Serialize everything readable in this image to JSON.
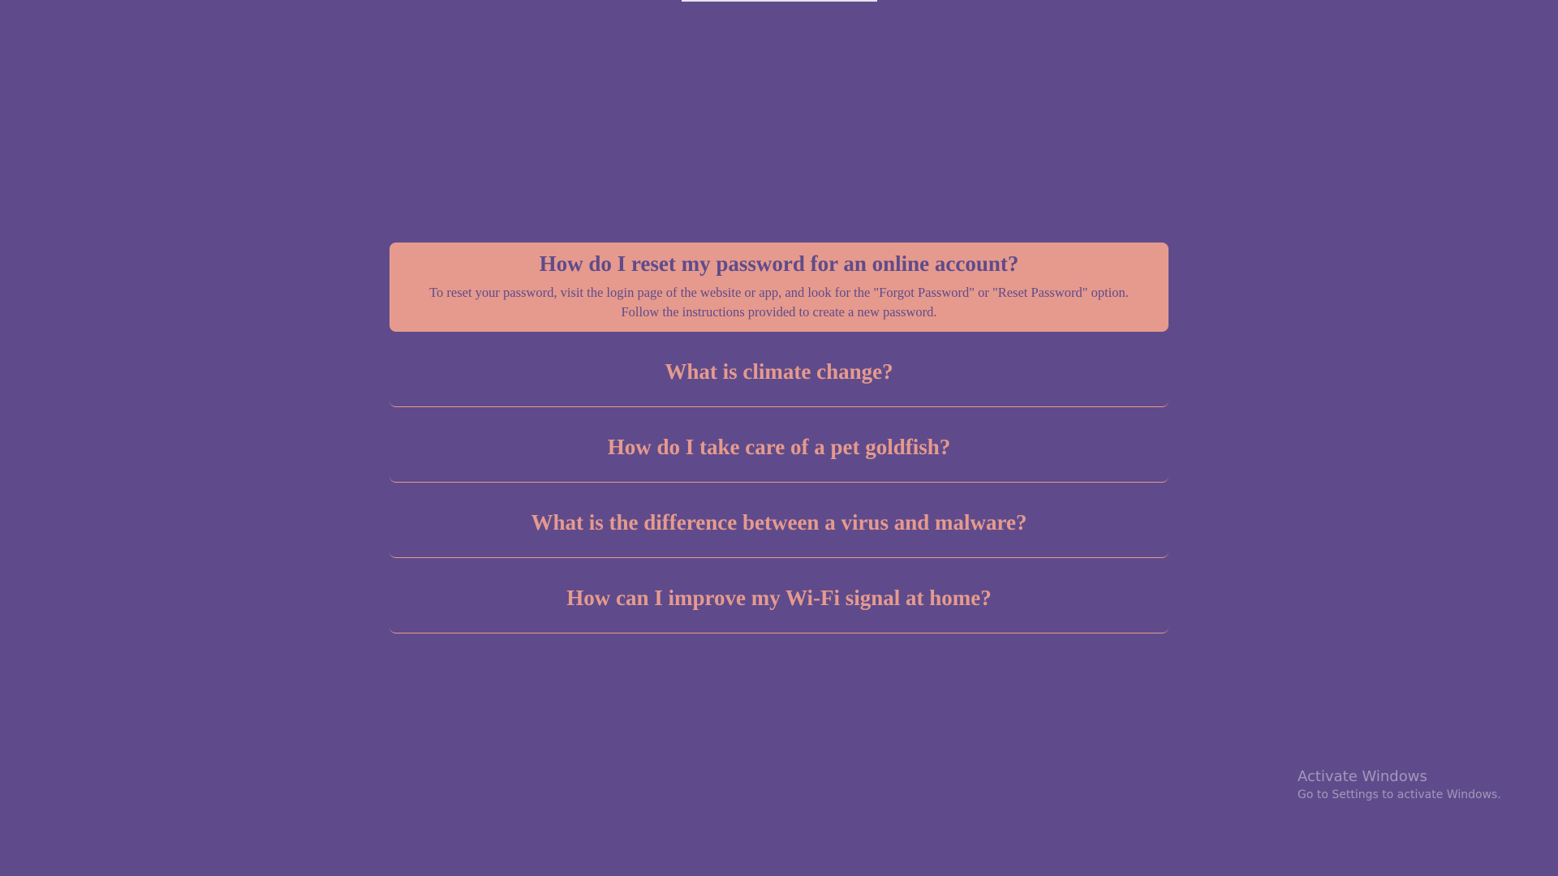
{
  "faq": {
    "items": [
      {
        "question": "How do I reset my password for an online account?",
        "answer": "To reset your password, visit the login page of the website or app, and look for the \"Forgot Password\" or \"Reset Password\" option. Follow the instructions provided to create a new password.",
        "expanded": true
      },
      {
        "question": "What is climate change?",
        "expanded": false
      },
      {
        "question": "How do I take care of a pet goldfish?",
        "expanded": false
      },
      {
        "question": "What is the difference between a virus and malware?",
        "expanded": false
      },
      {
        "question": "How can I improve my Wi-Fi signal at home?",
        "expanded": false
      }
    ]
  },
  "watermark": {
    "title": "Activate Windows",
    "subtitle": "Go to Settings to activate Windows."
  },
  "colors": {
    "background": "#5f4b8b",
    "accent": "#e69a8d"
  }
}
